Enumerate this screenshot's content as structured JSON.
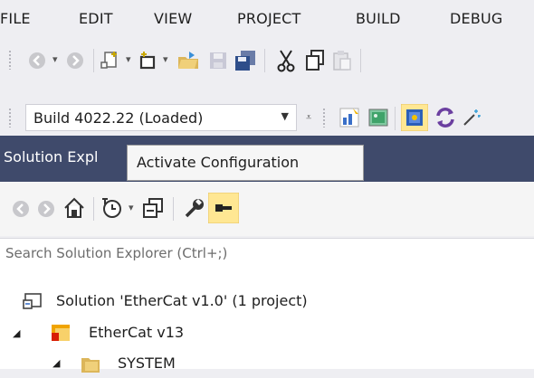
{
  "menu": {
    "items": [
      "FILE",
      "EDIT",
      "VIEW",
      "PROJECT",
      "BUILD",
      "DEBUG"
    ]
  },
  "toolbar": {
    "build_config": "Build 4022.22 (Loaded)"
  },
  "solution_explorer": {
    "title": "Solution Expl",
    "tooltip": "Activate Configuration",
    "search_placeholder": "Search Solution Explorer (Ctrl+;)"
  },
  "tree": {
    "solution": "Solution 'EtherCat v1.0' (1 project)",
    "project": "EtherCat v13",
    "system": "SYSTEM"
  },
  "colors": {
    "chrome_bg": "#eeeef2",
    "tab_strip": "#3f4a6b",
    "active_button": "#ffe793",
    "tooltip_bg": "#f6f6f6"
  },
  "icons": [
    "back-icon",
    "forward-icon",
    "new-project-icon",
    "add-item-icon",
    "open-folder-icon",
    "save-icon",
    "save-all-icon",
    "cut-icon",
    "copy-icon",
    "paste-icon",
    "grid-select-icon",
    "image-icon",
    "activate-config-icon",
    "refresh-icon",
    "magic-wand-icon",
    "home-icon",
    "history-icon",
    "collapse-all-icon",
    "properties-wrench-icon",
    "preview-icon",
    "solution-icon",
    "project-icon",
    "folder-icon"
  ]
}
